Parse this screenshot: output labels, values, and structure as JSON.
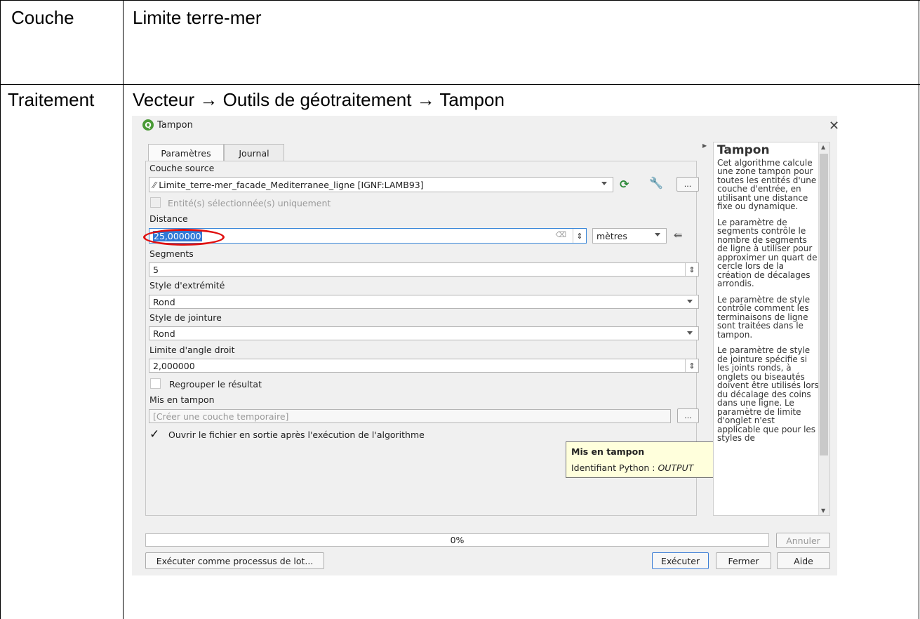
{
  "doc": {
    "rows": [
      {
        "label": "Couche",
        "value": "Limite terre-mer"
      },
      {
        "label": "Traitement",
        "value": "Vecteur → Outils de géotraitement → Tampon"
      }
    ]
  },
  "dialog": {
    "title": "Tampon",
    "tabs": [
      "Paramètres",
      "Journal"
    ],
    "source_label": "Couche source",
    "source_value": "Limite_terre-mer_facade_Mediterranee_ligne [IGNF:LAMB93]",
    "selected_only_label": "Entité(s) sélectionnée(s) uniquement",
    "distance_label": "Distance",
    "distance_value": "25,000000",
    "distance_unit": "mètres",
    "segments_label": "Segments",
    "segments_value": "5",
    "end_cap_label": "Style d'extrémité",
    "end_cap_value": "Rond",
    "join_label": "Style de jointure",
    "join_value": "Rond",
    "miter_label": "Limite d'angle droit",
    "miter_value": "2,000000",
    "dissolve_label": "Regrouper le résultat",
    "output_label": "Mis en tampon",
    "output_placeholder": "[Créer une couche temporaire]",
    "open_output_label": "Ouvrir le fichier en sortie après l'exécution de l'algorithme",
    "progress_text": "0%",
    "cancel_label": "Annuler",
    "batch_label": "Exécuter comme processus de lot...",
    "run_label": "Exécuter",
    "close_label": "Fermer",
    "help_label": "Aide",
    "ellipsis": "...",
    "tooltip": {
      "title": "Mis en tampon",
      "prefix": "Identifiant Python : ",
      "id": "OUTPUT"
    },
    "help_panel": {
      "title": "Tampon",
      "paragraphs": [
        "Cet algorithme calcule une zone tampon pour toutes les entités d'une couche d'entrée, en utilisant une distance fixe ou dynamique.",
        "Le paramètre de segments contrôle le nombre de segments de ligne à utiliser pour approximer un quart de cercle lors de la création de décalages arrondis.",
        "Le paramètre de style contrôle comment les terminaisons de ligne sont traitées dans le tampon.",
        "Le paramètre de style de jointure spécifie si les joints ronds, à onglets ou biseautés doivent être utilisés lors du décalage des coins dans une ligne. Le paramètre de limite d'onglet n'est applicable que pour les styles de"
      ]
    }
  }
}
